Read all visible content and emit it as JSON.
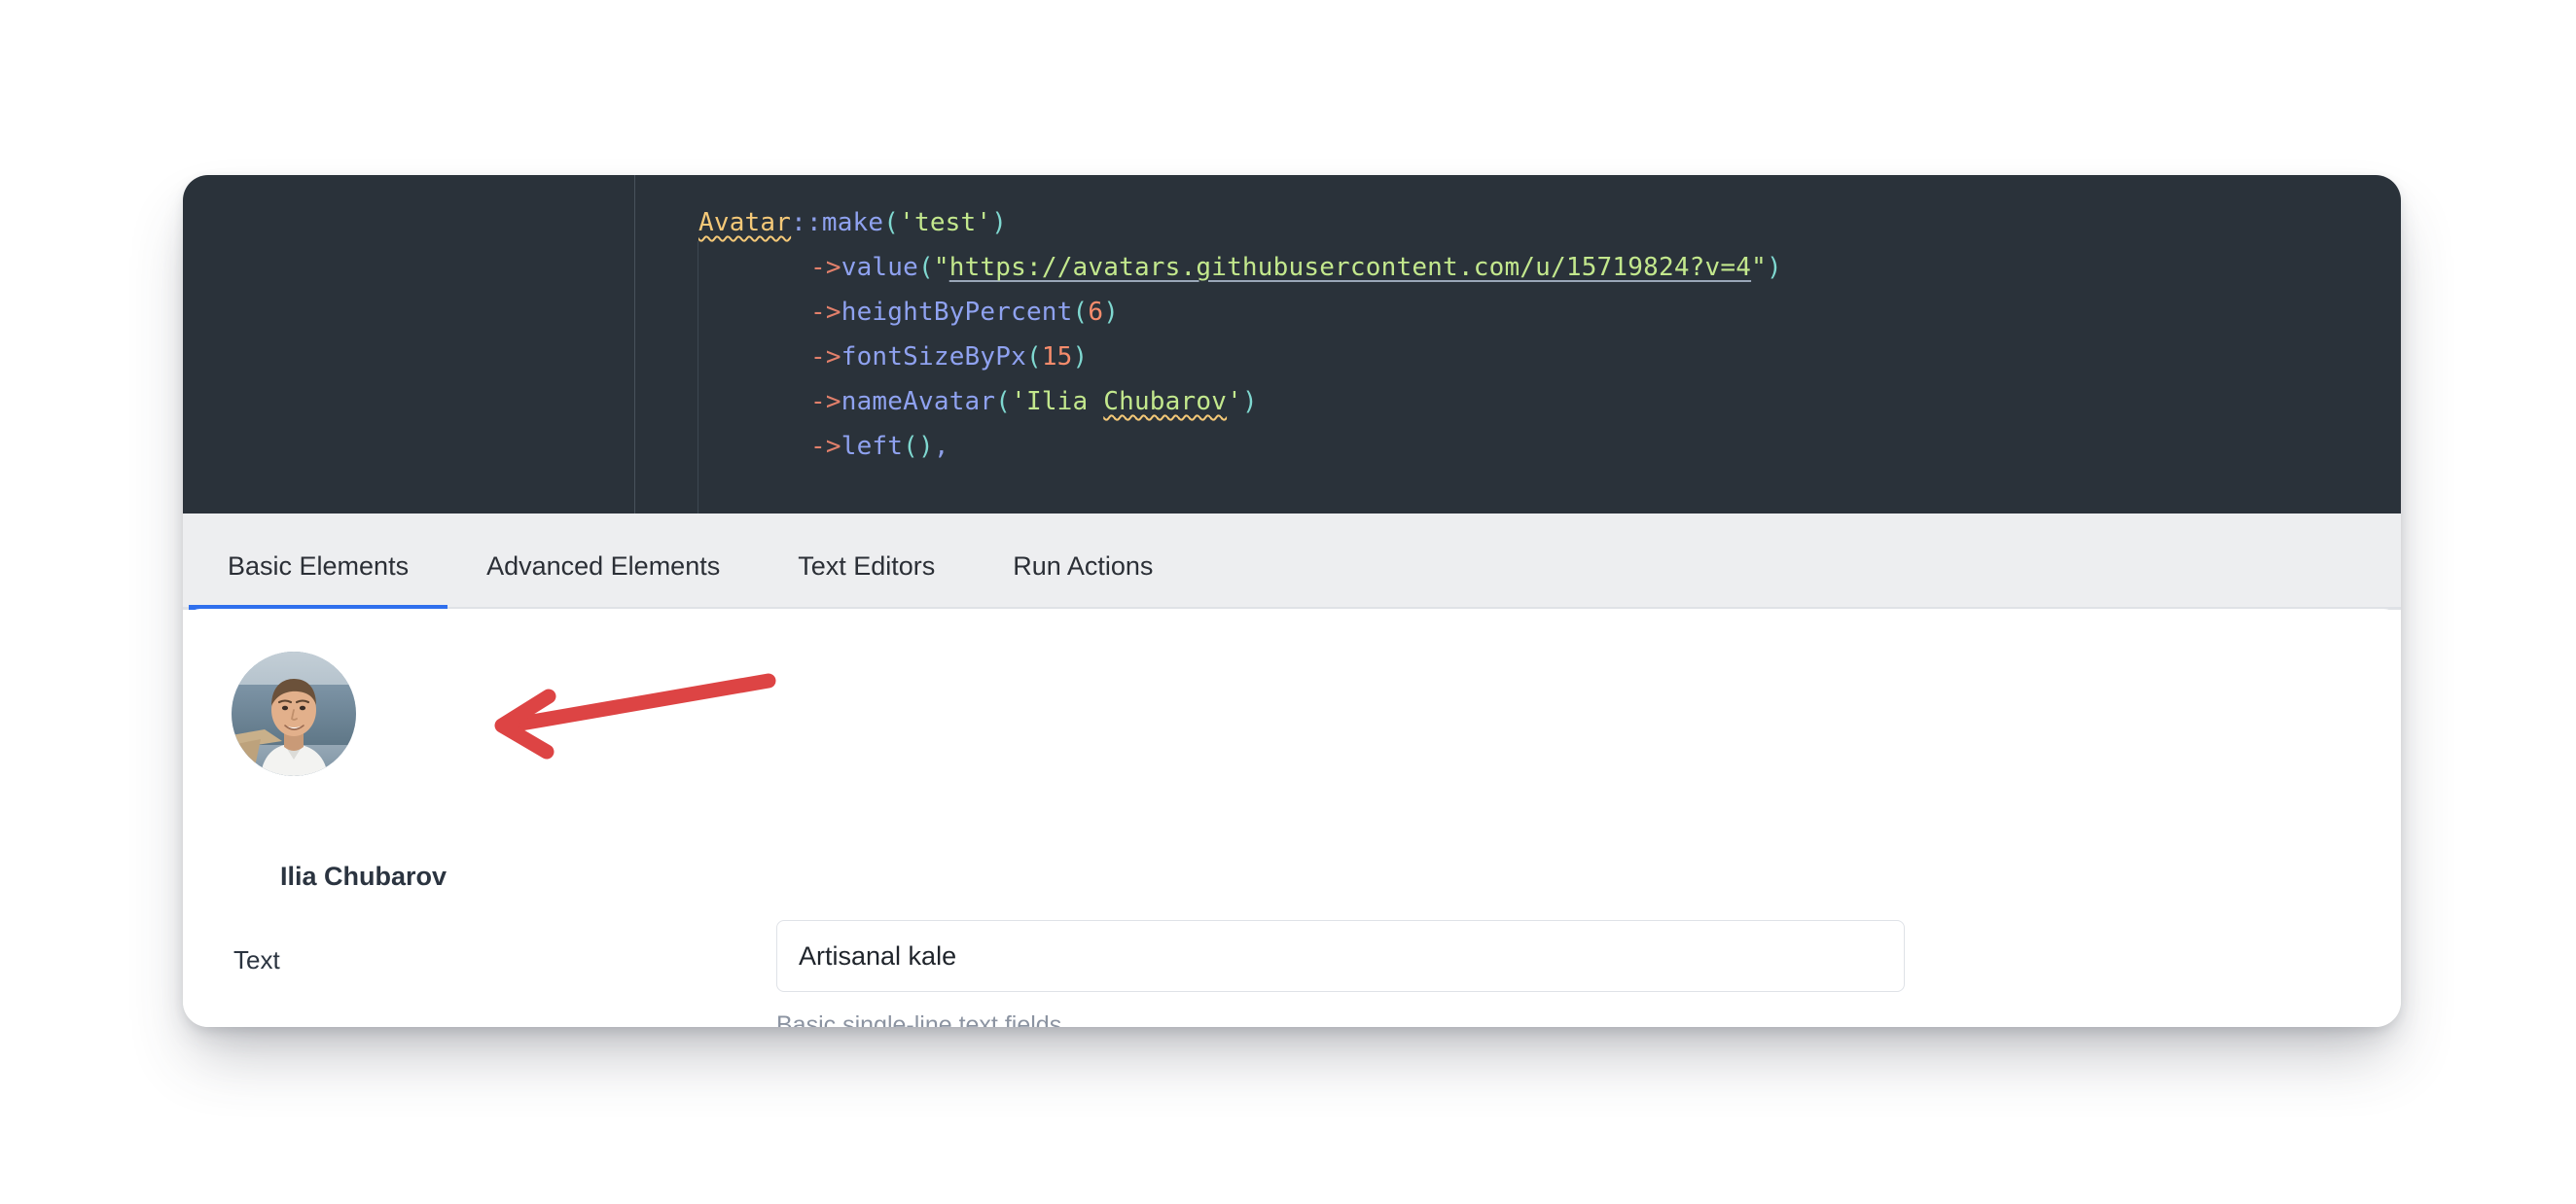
{
  "card": {
    "accent_color": "#2f6fed",
    "code_bg": "#2a323a",
    "tabbar_bg": "#edeef0",
    "annotation_color": "#dd4444"
  },
  "code": {
    "language": "php",
    "lines": [
      {
        "indent": 0,
        "tokens": [
          {
            "type": "class",
            "text": "Avatar"
          },
          {
            "type": "op",
            "text": "::"
          },
          {
            "type": "fn",
            "text": "make"
          },
          {
            "type": "paren",
            "text": "("
          },
          {
            "type": "str",
            "text": "'test'"
          },
          {
            "type": "paren",
            "text": ")"
          }
        ]
      },
      {
        "indent": 1,
        "tokens": [
          {
            "type": "arrow",
            "text": "->"
          },
          {
            "type": "fn",
            "text": "value"
          },
          {
            "type": "paren",
            "text": "("
          },
          {
            "type": "str",
            "text": "\""
          },
          {
            "type": "url",
            "text": "https://avatars.githubusercontent.com/u/15719824?v=4"
          },
          {
            "type": "str",
            "text": "\""
          },
          {
            "type": "paren",
            "text": ")"
          }
        ]
      },
      {
        "indent": 1,
        "tokens": [
          {
            "type": "arrow",
            "text": "->"
          },
          {
            "type": "fn",
            "text": "heightByPercent"
          },
          {
            "type": "paren",
            "text": "("
          },
          {
            "type": "num",
            "text": "6"
          },
          {
            "type": "paren",
            "text": ")"
          }
        ]
      },
      {
        "indent": 1,
        "tokens": [
          {
            "type": "arrow",
            "text": "->"
          },
          {
            "type": "fn",
            "text": "fontSizeByPx"
          },
          {
            "type": "paren",
            "text": "("
          },
          {
            "type": "num",
            "text": "15"
          },
          {
            "type": "paren",
            "text": ")"
          }
        ]
      },
      {
        "indent": 1,
        "tokens": [
          {
            "type": "arrow",
            "text": "->"
          },
          {
            "type": "fn",
            "text": "nameAvatar"
          },
          {
            "type": "paren",
            "text": "("
          },
          {
            "type": "str",
            "text": "'Ilia "
          },
          {
            "type": "spell",
            "text": "Chubarov"
          },
          {
            "type": "str",
            "text": "'"
          },
          {
            "type": "paren",
            "text": ")"
          }
        ]
      },
      {
        "indent": 1,
        "tokens": [
          {
            "type": "arrow",
            "text": "->"
          },
          {
            "type": "fn",
            "text": "left"
          },
          {
            "type": "paren",
            "text": "()"
          },
          {
            "type": "comma",
            "text": ","
          }
        ]
      }
    ]
  },
  "tabs": [
    {
      "label": "Basic Elements",
      "active": true
    },
    {
      "label": "Advanced Elements",
      "active": false
    },
    {
      "label": "Text Editors",
      "active": false
    },
    {
      "label": "Run Actions",
      "active": false
    }
  ],
  "preview": {
    "avatar_name": "Ilia Chubarov",
    "avatar_alt": "Ilia Chubarov profile photo",
    "field": {
      "label": "Text",
      "value": "Artisanal kale",
      "placeholder": "",
      "hint": "Basic single-line text fields."
    }
  }
}
